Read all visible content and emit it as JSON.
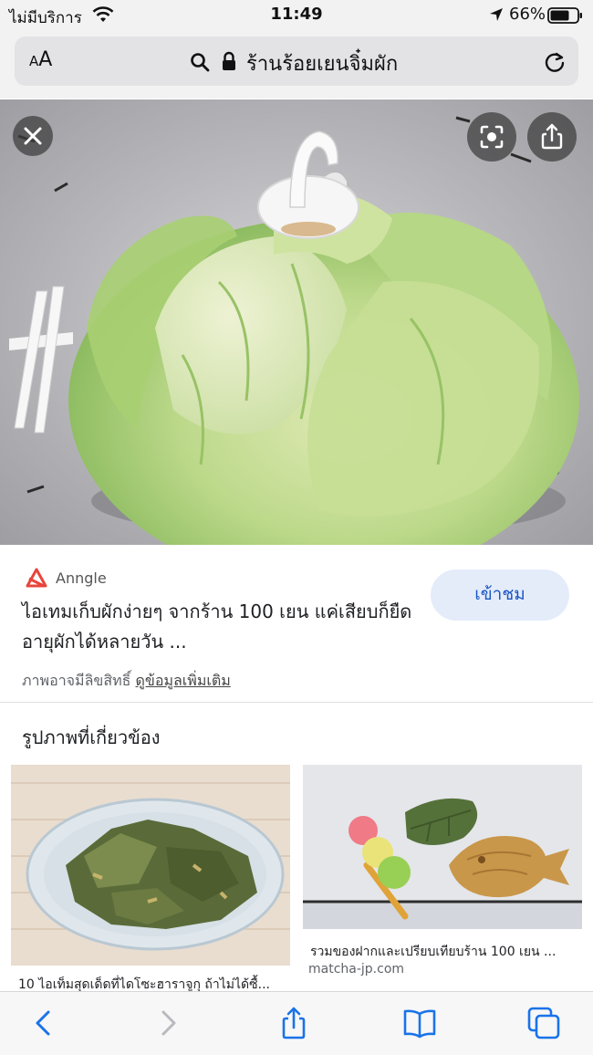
{
  "status": {
    "carrier": "ไม่มีบริการ",
    "time": "11:49",
    "battery": "66%"
  },
  "address_bar": {
    "text_size_small": "A",
    "text_size_large": "A",
    "url_text": "ร้านร้อยเยนจิ๋มผัก"
  },
  "result": {
    "source": "Anngle",
    "title": "ไอเทมเก็บผักง่ายๆ จากร้าน 100 เยน แค่เสียบก็ยืดอายุผักได้หลายวัน ...",
    "visit_label": "เข้าชม",
    "copyright_text": "ภาพอาจมีลิขสิทธิ์",
    "more_info_label": "ดูข้อมูลเพิ่มเติม"
  },
  "related": {
    "heading": "รูปภาพที่เกี่ยวข้อง",
    "items": [
      {
        "caption": "10 ไอเท็มสุดเด็ดที่ไดโซะฮาราจูกุ ถ้าไม่ได้ซื้...",
        "source": ""
      },
      {
        "caption": "รวมของฝากและเปรียบเทียบร้าน 100 เยน ...",
        "source": "matcha-jp.com"
      }
    ]
  },
  "icons": {
    "close": "close-icon",
    "visual_search": "visual-search-icon",
    "share": "share-icon",
    "back": "chevron-left-icon",
    "forward": "chevron-right-icon",
    "bookmarks": "book-icon",
    "tabs": "tabs-icon"
  },
  "colors": {
    "accent": "#1a73e8",
    "visit_bg": "#e4ecfa",
    "source_logo": "#e8453c"
  }
}
